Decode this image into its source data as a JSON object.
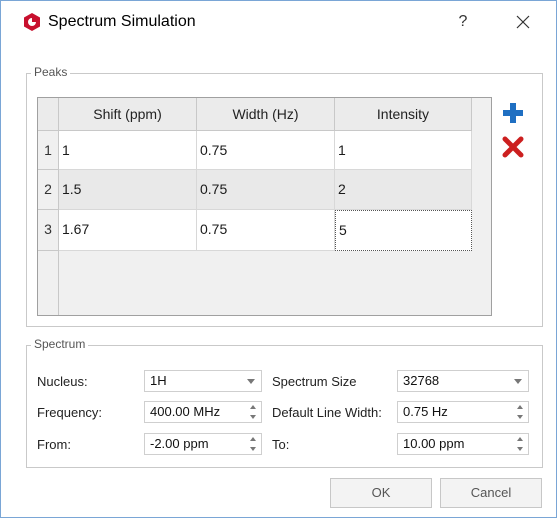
{
  "window": {
    "title": "Spectrum Simulation",
    "help_label": "?"
  },
  "peaks": {
    "legend": "Peaks",
    "columns": [
      "Shift (ppm)",
      "Width (Hz)",
      "Intensity"
    ],
    "rows": [
      {
        "index": "1",
        "shift": "1",
        "width": "0.75",
        "intensity": "1"
      },
      {
        "index": "2",
        "shift": "1.5",
        "width": "0.75",
        "intensity": "2"
      },
      {
        "index": "3",
        "shift": "1.67",
        "width": "0.75",
        "intensity": "5"
      }
    ],
    "add_icon": "plus-icon",
    "remove_icon": "delete-x-icon"
  },
  "spectrum": {
    "legend": "Spectrum",
    "nucleus_label": "Nucleus:",
    "nucleus_value": "1H",
    "size_label": "Spectrum Size",
    "size_value": "32768",
    "frequency_label": "Frequency:",
    "frequency_value": "400.00 MHz",
    "line_width_label": "Default Line Width:",
    "line_width_value": "0.75 Hz",
    "from_label": "From:",
    "from_value": "-2.00 ppm",
    "to_label": "To:",
    "to_value": "10.00 ppm"
  },
  "buttons": {
    "ok": "OK",
    "cancel": "Cancel"
  },
  "colors": {
    "accent_blue": "#1f6fc2",
    "delete_red": "#cc1f1f",
    "app_icon_red": "#c8102e",
    "window_border": "#7aa6d6"
  }
}
